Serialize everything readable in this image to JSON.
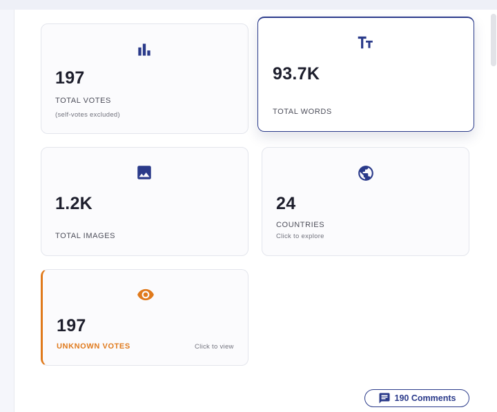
{
  "colors": {
    "accent": "#2a3a8a",
    "warning": "#e07a1c",
    "text": "#1d1e2c",
    "muted": "#70717c"
  },
  "stats": {
    "total_votes": {
      "icon": "bar-chart-icon",
      "value": "197",
      "label": "TOTAL VOTES",
      "sub": "(self-votes excluded)"
    },
    "total_words": {
      "icon": "text-size-icon",
      "value": "93.7K",
      "label": "TOTAL WORDS"
    },
    "total_images": {
      "icon": "image-icon",
      "value": "1.2K",
      "label": "TOTAL IMAGES"
    },
    "countries": {
      "icon": "globe-icon",
      "value": "24",
      "label": "COUNTRIES",
      "sub": "Click to explore"
    },
    "unknown_votes": {
      "icon": "eye-icon",
      "value": "197",
      "label": "UNKNOWN VOTES",
      "sub": "Click to view"
    }
  },
  "comments_button": {
    "icon": "comment-icon",
    "label": "190 Comments"
  }
}
